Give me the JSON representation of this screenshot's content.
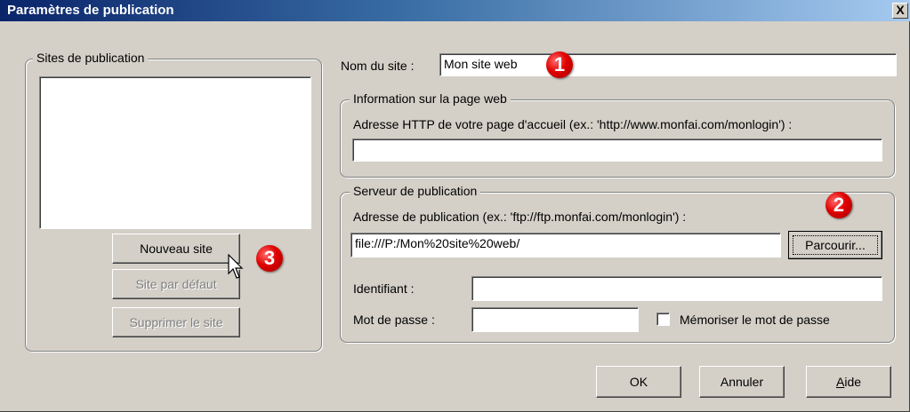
{
  "window": {
    "title": "Paramètres de publication",
    "close_label": "X"
  },
  "sites_group": {
    "legend": "Sites de publication",
    "new_site_label": "Nouveau site",
    "default_site_label": "Site par défaut",
    "delete_site_label": "Supprimer le site"
  },
  "site_name": {
    "label": "Nom du site :",
    "value": "Mon site web"
  },
  "web_page_group": {
    "legend": "Information sur la page web",
    "http_label": "Adresse HTTP de votre page d'accueil (ex.: 'http://www.monfai.com/monlogin') :",
    "http_value": ""
  },
  "server_group": {
    "legend": "Serveur de publication",
    "publish_label": "Adresse de publication (ex.: 'ftp://ftp.monfai.com/monlogin') :",
    "publish_value": "file:///P:/Mon%20site%20web/",
    "browse_label": "Parcourir...",
    "username_label": "Identifiant :",
    "username_value": "",
    "password_label": "Mot de passe :",
    "password_value": "",
    "remember_label": "Mémoriser le mot de passe"
  },
  "footer": {
    "ok_label": "OK",
    "cancel_label": "Annuler",
    "help_label": "Aide"
  },
  "annotations": {
    "badge1": "1",
    "badge2": "2",
    "badge3": "3"
  },
  "colors": {
    "titlebar_start": "#0a246a",
    "dialog_bg": "#d4d0c8",
    "badge_red": "#e00000"
  }
}
